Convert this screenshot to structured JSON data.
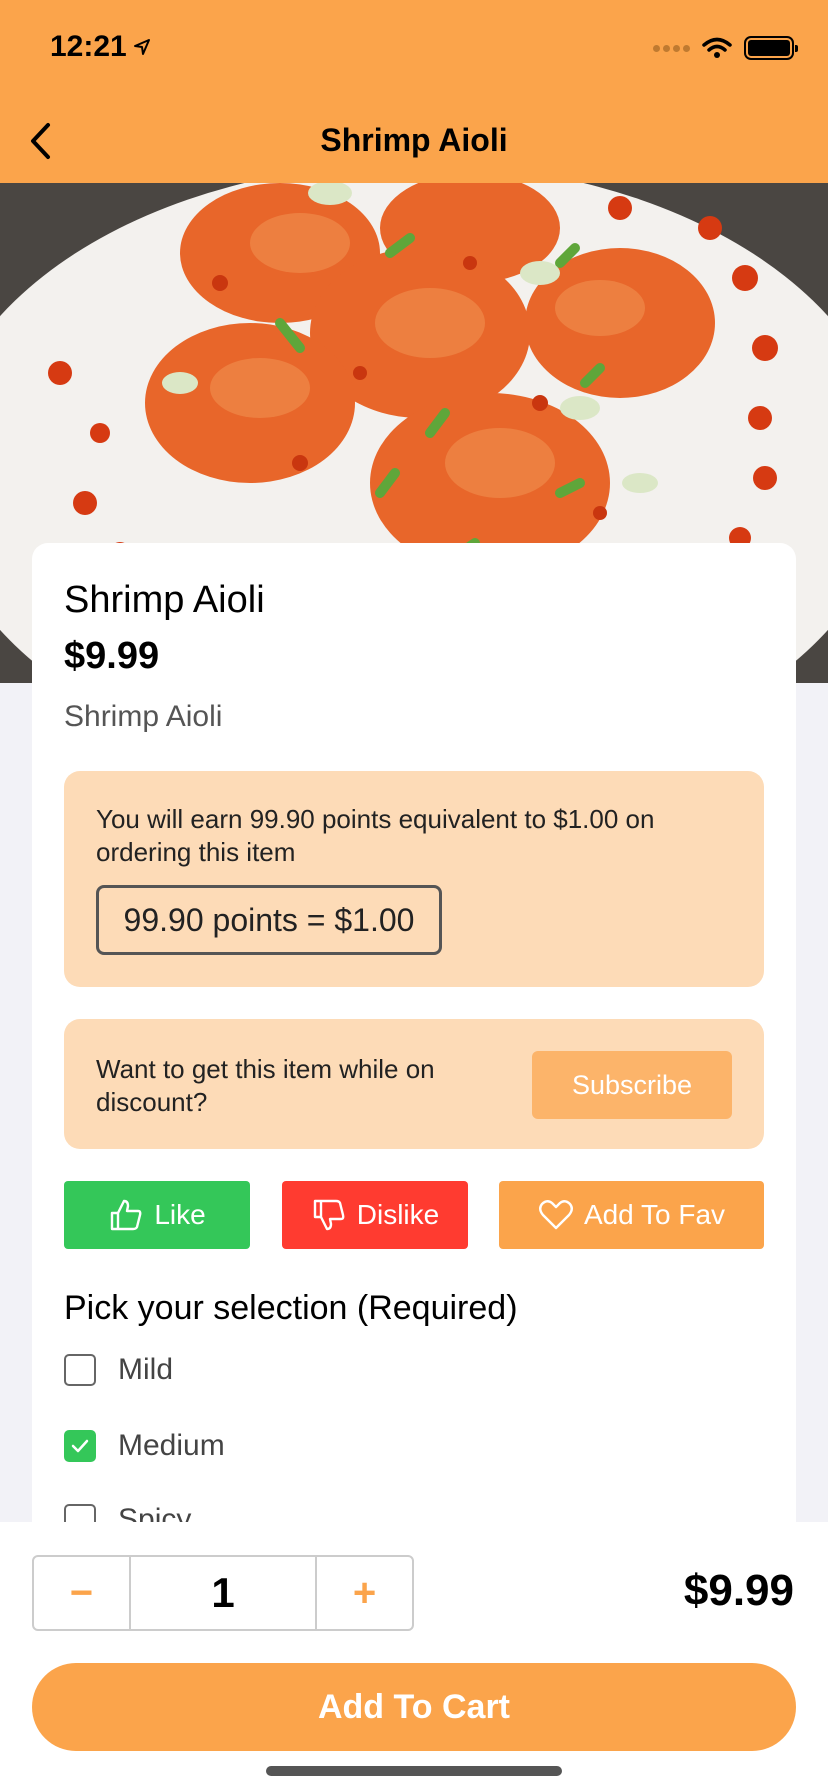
{
  "status_bar": {
    "time": "12:21"
  },
  "nav": {
    "title": "Shrimp Aioli",
    "back_icon": "chevron-left-icon"
  },
  "item": {
    "name": "Shrimp Aioli",
    "price": "$9.99",
    "description": "Shrimp Aioli"
  },
  "points": {
    "message": "You will earn 99.90 points equivalent to $1.00 on ordering this item",
    "badge": "99.90 points = $1.00"
  },
  "subscribe": {
    "message": "Want to get this item while on discount?",
    "button": "Subscribe"
  },
  "actions": {
    "like": "Like",
    "dislike": "Dislike",
    "fav": "Add To Fav"
  },
  "selection": {
    "title": "Pick your selection (Required)",
    "options": [
      {
        "label": "Mild",
        "checked": false
      },
      {
        "label": "Medium",
        "checked": true
      },
      {
        "label": "Spicy",
        "checked": false
      }
    ]
  },
  "cart": {
    "minus": "−",
    "quantity": "1",
    "plus": "+",
    "total": "$9.99",
    "button": "Add To Cart"
  },
  "colors": {
    "brand": "#fba44b",
    "like": "#34c759",
    "dislike": "#ff3b30",
    "panel": "#fddbb7"
  }
}
